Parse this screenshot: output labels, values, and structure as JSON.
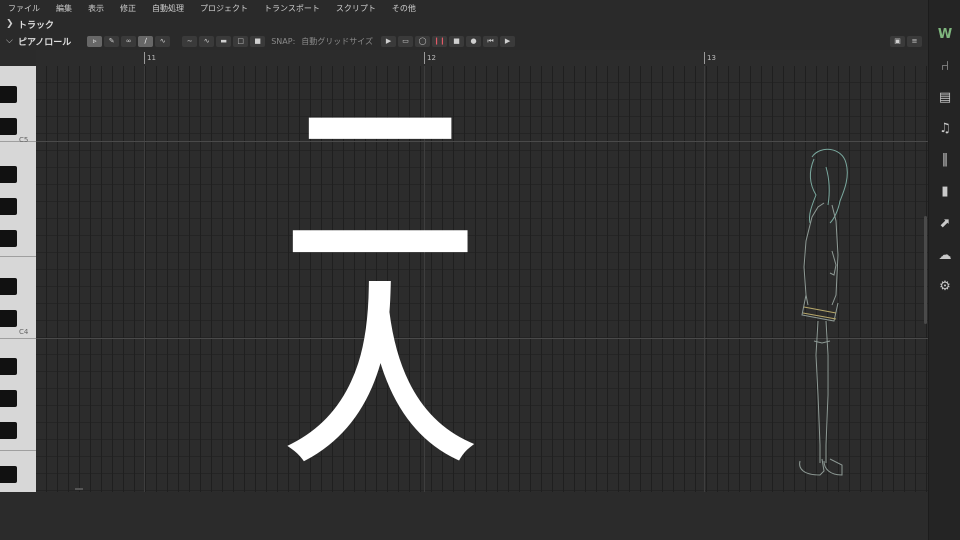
{
  "menu": {
    "items": [
      "ファイル",
      "編集",
      "表示",
      "修正",
      "自動処理",
      "プロジェクト",
      "トランスポート",
      "スクリプト",
      "その他"
    ]
  },
  "track_section": {
    "label": "トラック"
  },
  "pianoroll": {
    "label": "ピアノロール",
    "snap_label": "SNAP:",
    "snap_value": "自動グリッドサイズ"
  },
  "ruler": {
    "marks": [
      "11",
      "12",
      "13"
    ]
  },
  "keyboard": {
    "labels": [
      "C5",
      "C4"
    ]
  },
  "overlay": {
    "text": "二人"
  },
  "colors": {
    "background": "#2b2b2b",
    "record": "#e35a67",
    "logo": "#7fb77e"
  },
  "sidebar": {
    "icons": [
      "logo-icon",
      "microphone-icon",
      "clapperboard-icon",
      "music-note-icon",
      "library-icon",
      "book-icon",
      "export-icon",
      "cloud-icon",
      "gear-icon"
    ]
  }
}
